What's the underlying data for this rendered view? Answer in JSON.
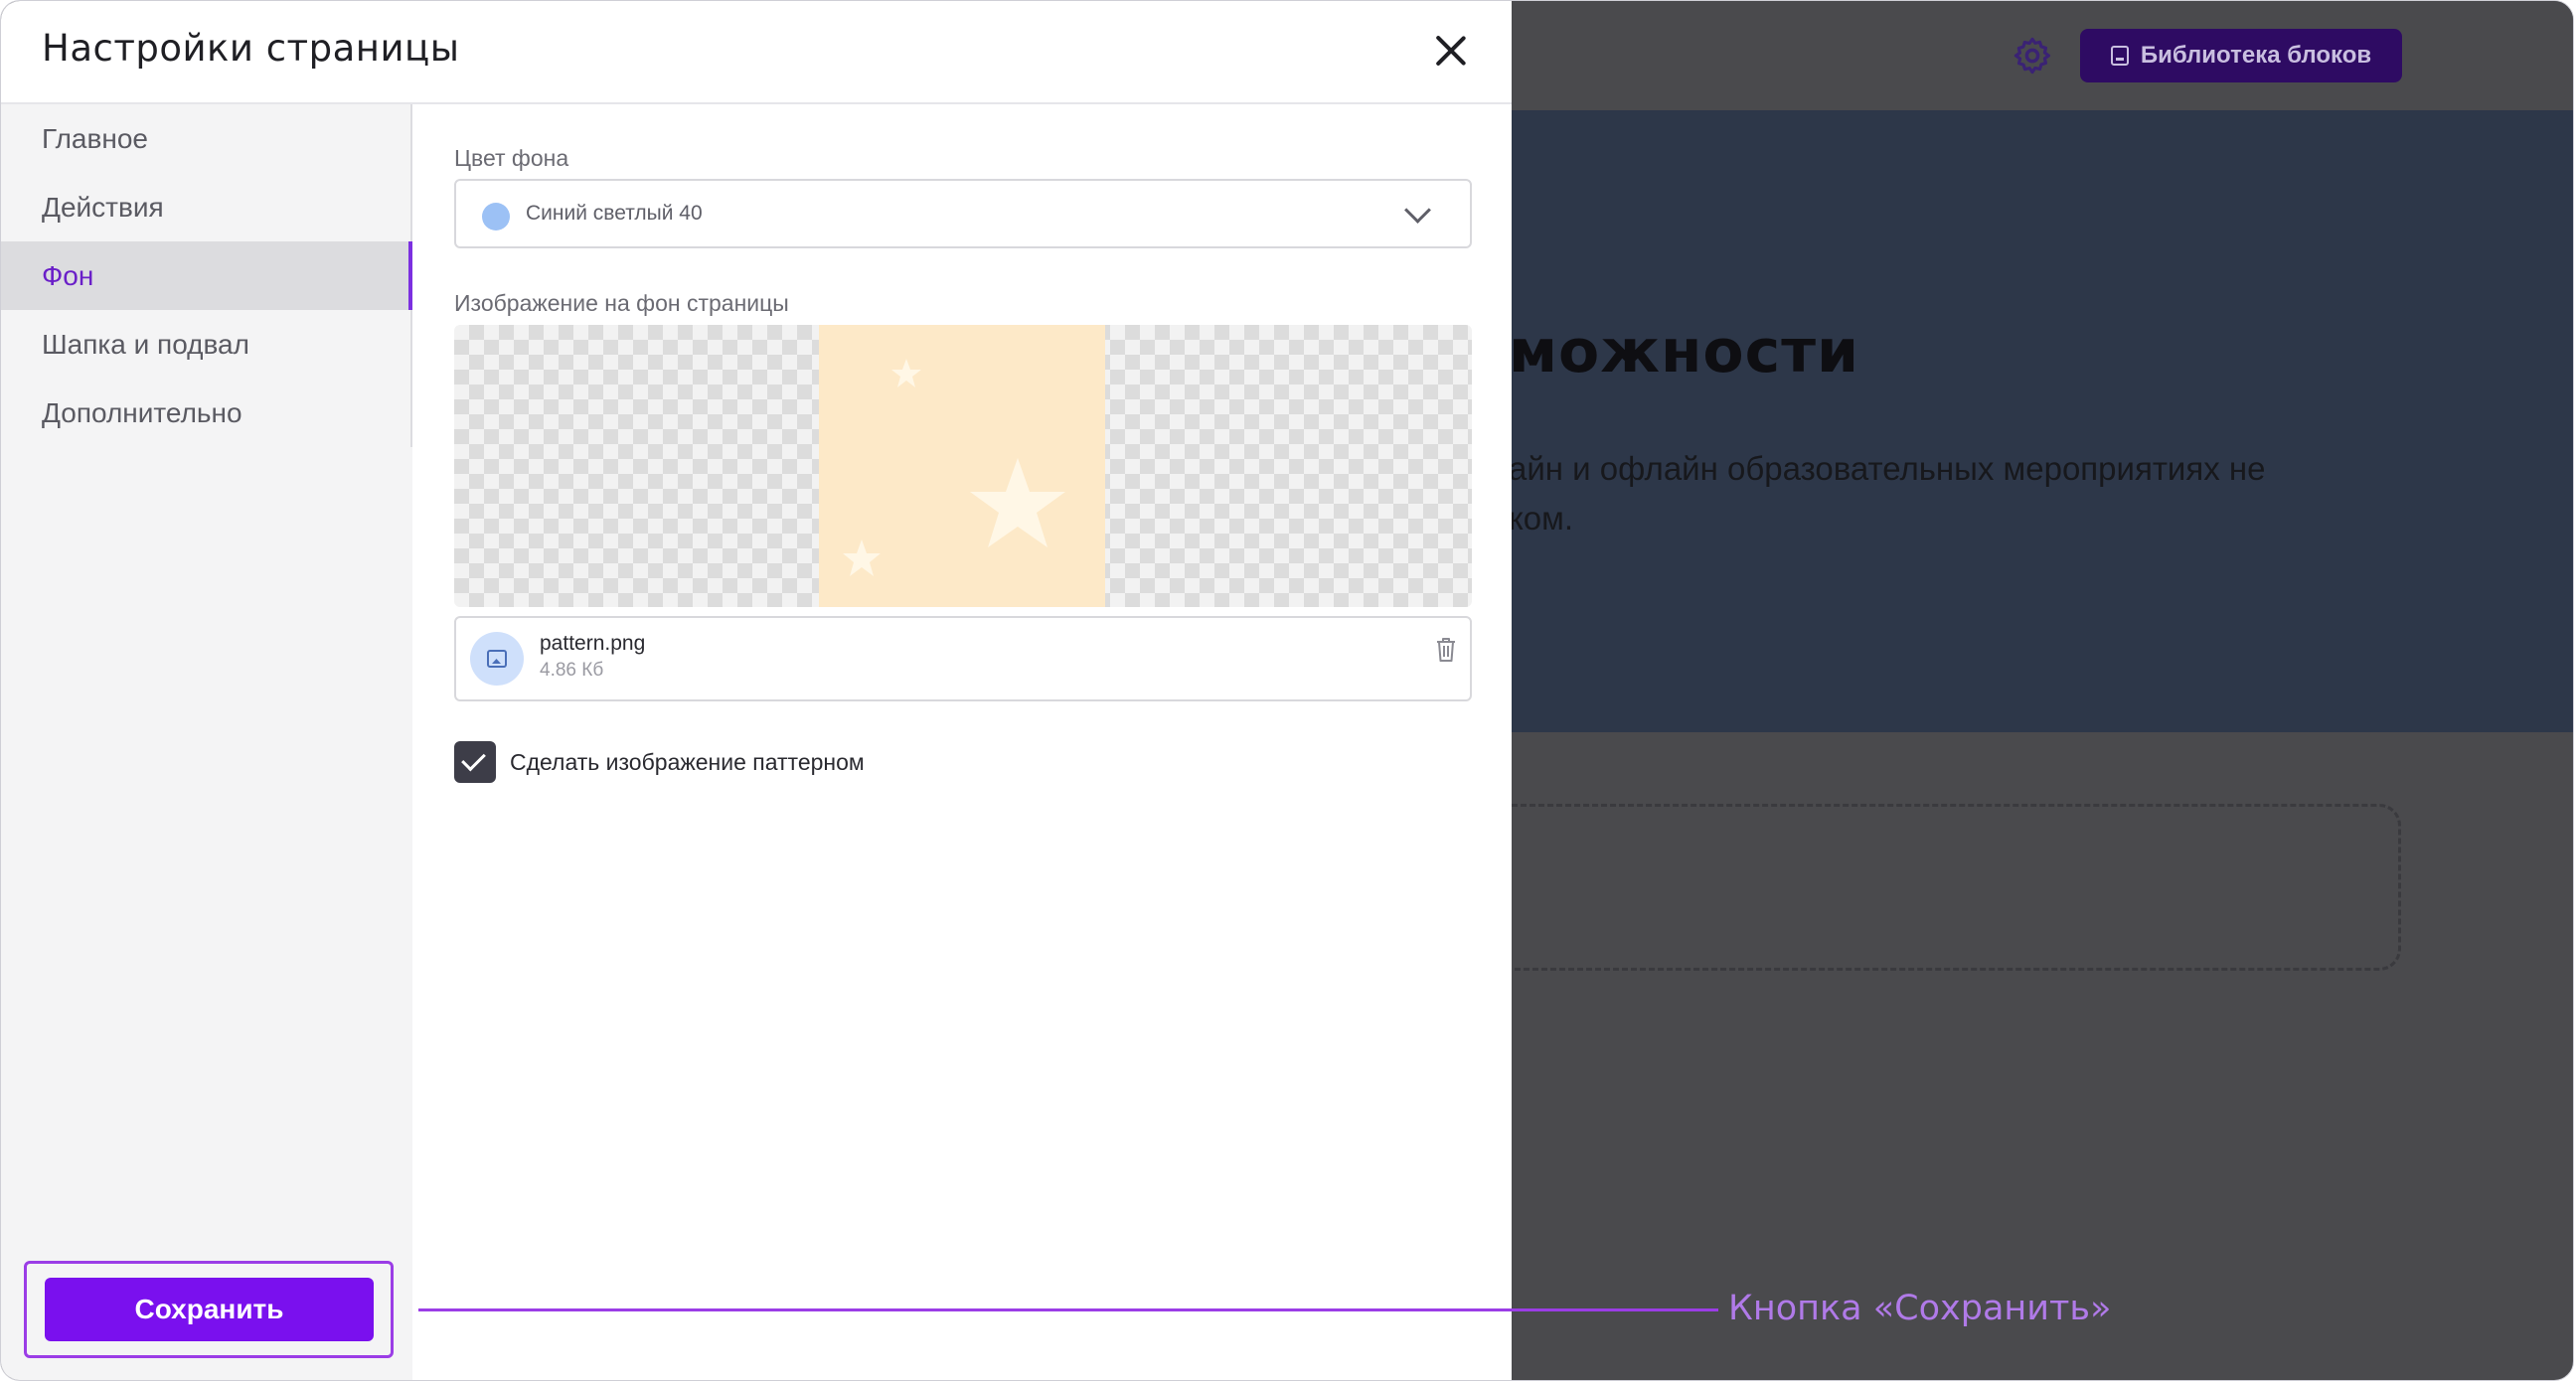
{
  "background_page": {
    "library_button_label": "Библиотека блоков",
    "hero_title": "можности",
    "hero_text_line1": "айн и офлайн образовательных мероприятиях не",
    "hero_text_line2": "ком."
  },
  "modal": {
    "title": "Настройки страницы",
    "nav": [
      {
        "label": "Главное",
        "active": false
      },
      {
        "label": "Действия",
        "active": false
      },
      {
        "label": "Фон",
        "active": true
      },
      {
        "label": "Шапка и подвал",
        "active": false
      },
      {
        "label": "Дополнительно",
        "active": false
      }
    ],
    "save_label": "Сохранить",
    "background_color": {
      "label": "Цвет фона",
      "value": "Синий светлый 40",
      "swatch": "#9cc1f5"
    },
    "background_image": {
      "label": "Изображение на фон страницы",
      "file_name": "pattern.png",
      "file_size": "4.86 Кб"
    },
    "pattern_checkbox": {
      "label": "Сделать изображение паттерном",
      "checked": true
    }
  },
  "annotation": {
    "text": "Кнопка «Сохранить»"
  },
  "colors": {
    "accent": "#7a10ee",
    "annotation": "#9b3de6",
    "overlay": "#4a4a4d",
    "hero": "#2d3749",
    "pattern_bg": "#fde9c8"
  }
}
